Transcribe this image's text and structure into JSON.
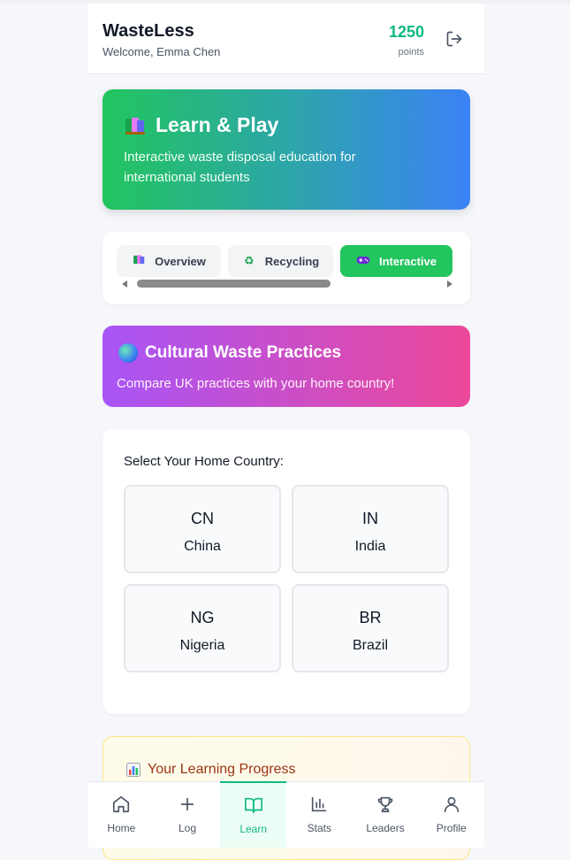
{
  "header": {
    "title": "WasteLess",
    "welcome": "Welcome, Emma Chen",
    "points_value": "1250",
    "points_label": "points"
  },
  "hero": {
    "title": "Learn & Play",
    "subtitle": "Interactive waste disposal education for international students"
  },
  "tabs": [
    {
      "label": "Overview",
      "icon": "books-icon",
      "active": false
    },
    {
      "label": "Recycling",
      "icon": "recycle-icon",
      "active": false
    },
    {
      "label": "Interactive",
      "icon": "gamepad-icon",
      "active": true
    }
  ],
  "culture": {
    "title": "Cultural Waste Practices",
    "subtitle": "Compare UK practices with your home country!"
  },
  "country_select": {
    "title": "Select Your Home Country:",
    "countries": [
      {
        "code": "CN",
        "name": "China"
      },
      {
        "code": "IN",
        "name": "India"
      },
      {
        "code": "NG",
        "name": "Nigeria"
      },
      {
        "code": "BR",
        "name": "Brazil"
      }
    ]
  },
  "progress": {
    "title": "Your Learning Progress"
  },
  "nav": [
    {
      "label": "Home",
      "icon": "home-icon"
    },
    {
      "label": "Log",
      "icon": "plus-icon"
    },
    {
      "label": "Learn",
      "icon": "book-open-icon",
      "active": true
    },
    {
      "label": "Stats",
      "icon": "bar-chart-icon"
    },
    {
      "label": "Leaders",
      "icon": "trophy-icon"
    },
    {
      "label": "Profile",
      "icon": "user-icon"
    }
  ],
  "colors": {
    "brand_green": "#10b981",
    "hero_gradient": [
      "#22c55e",
      "#3b82f6"
    ],
    "culture_gradient": [
      "#a855f7",
      "#ec4899"
    ]
  }
}
